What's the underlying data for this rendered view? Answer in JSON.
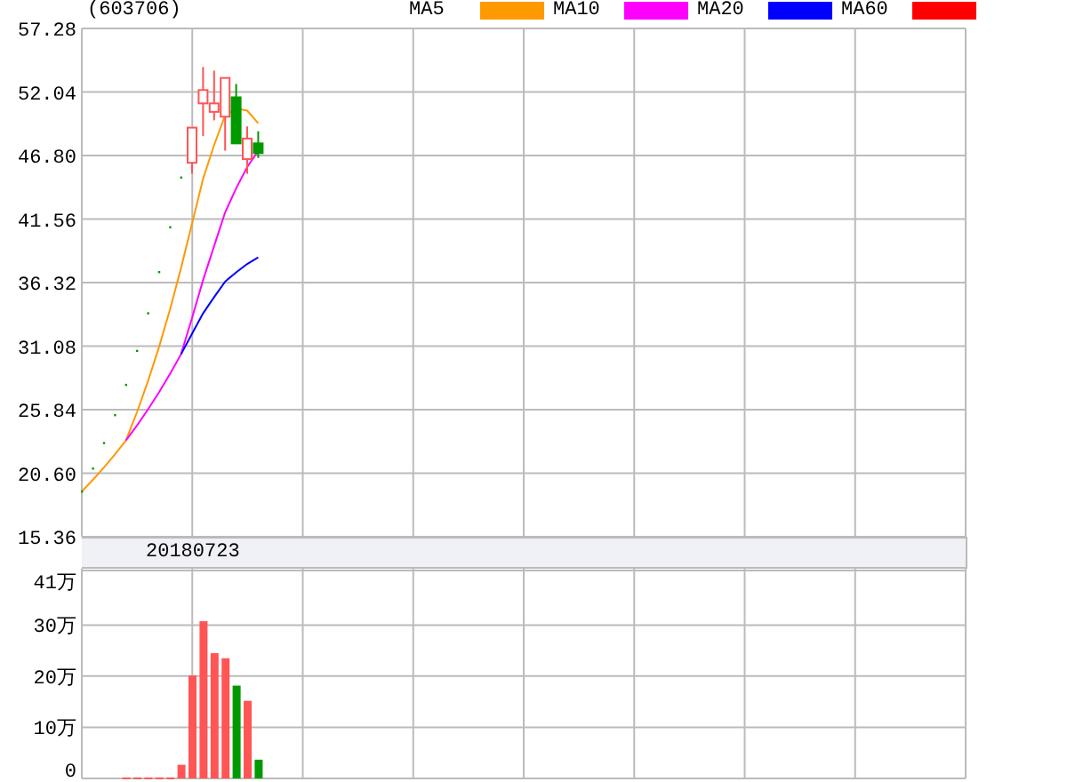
{
  "stock_code": "(603706)",
  "legend": [
    {
      "label": "MA5",
      "color": "#ff9900"
    },
    {
      "label": "MA10",
      "color": "#ff00ff"
    },
    {
      "label": "MA20",
      "color": "#0000ff"
    },
    {
      "label": "MA60",
      "color": "#ff0000"
    }
  ],
  "price_axis_labels": [
    "57.28",
    "52.04",
    "46.80",
    "41.56",
    "36.32",
    "31.08",
    "25.84",
    "20.60",
    "15.36"
  ],
  "date_label": "20180723",
  "volume_axis_labels": [
    "41万",
    "30万",
    "20万",
    "10万",
    "0"
  ]
}
